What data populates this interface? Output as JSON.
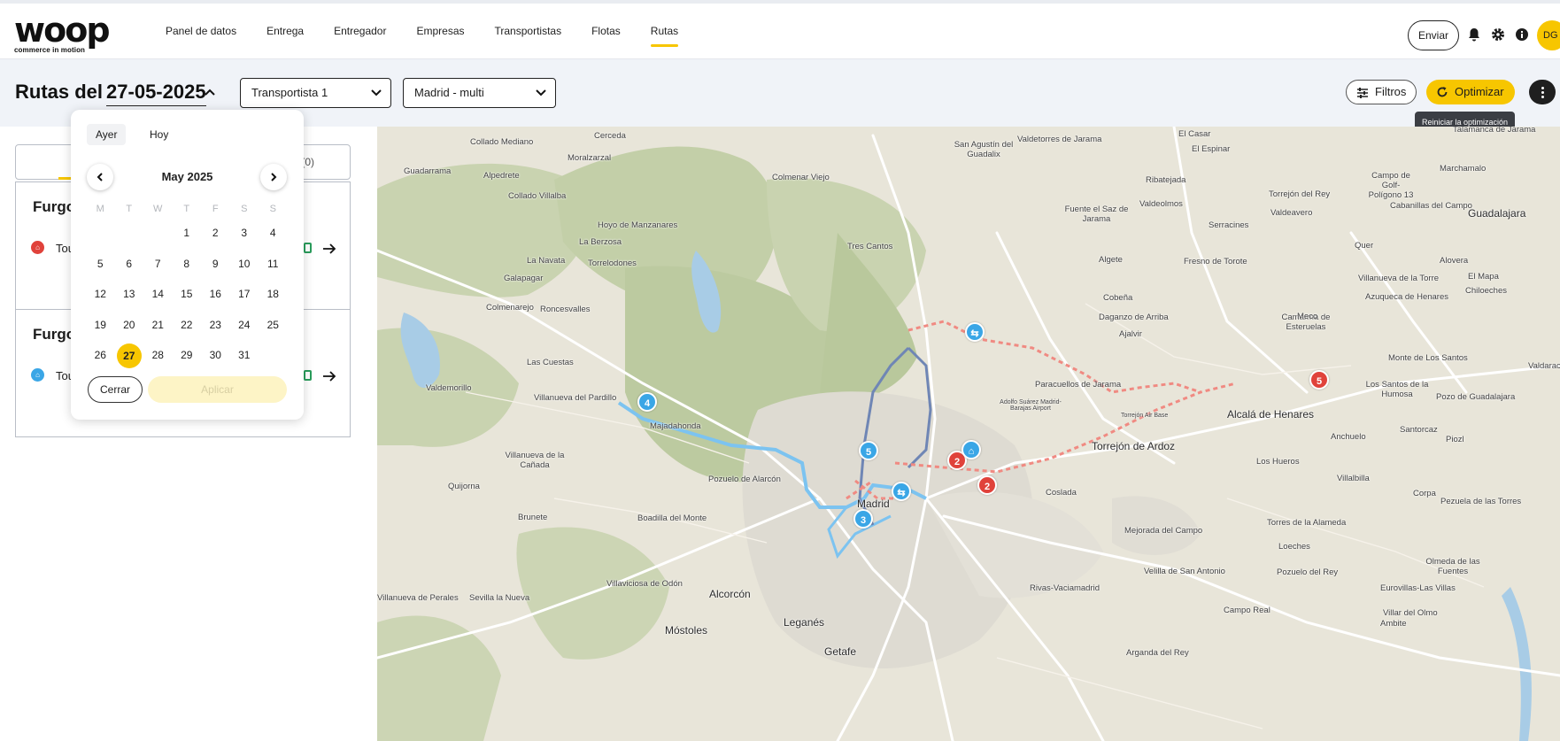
{
  "brand": {
    "logo_text": "woop",
    "tagline": "commerce in motion"
  },
  "nav": [
    {
      "label": "Panel de datos",
      "active": false
    },
    {
      "label": "Entrega",
      "active": false
    },
    {
      "label": "Entregador",
      "active": false
    },
    {
      "label": "Empresas",
      "active": false
    },
    {
      "label": "Transportistas",
      "active": false
    },
    {
      "label": "Flotas",
      "active": false
    },
    {
      "label": "Rutas",
      "active": true
    }
  ],
  "topbar": {
    "send_label": "Enviar",
    "avatar_initials": "DG",
    "icons": [
      "bell-icon",
      "gear-icon",
      "info-icon"
    ]
  },
  "header": {
    "title_prefix": "Rutas del",
    "date": "27-05-2025",
    "carrier_select": "Transportista 1",
    "zone_select": "Madrid - multi",
    "filters_label": "Filtros",
    "optimize_label": "Optimizar",
    "tooltip": "Reiniciar la optimización"
  },
  "colors": {
    "accent": "#f7c600",
    "route_blue": "#3aa6e6",
    "route_red": "#e0423b",
    "route_navy": "#6f86b5"
  },
  "left_panel": {
    "tab_count": "(0)",
    "cards": [
      {
        "title": "Furgo",
        "tour": "Tou",
        "dot_color": "#e0423b"
      },
      {
        "title": "Furgo",
        "tour": "Tou",
        "dot_color": "#3aa6e6"
      }
    ]
  },
  "calendar": {
    "quick": [
      "Ayer",
      "Hoy"
    ],
    "month_label": "May 2025",
    "weekdays": [
      "M",
      "T",
      "W",
      "T",
      "F",
      "S",
      "S"
    ],
    "weeks": [
      [
        "",
        "",
        "",
        "1",
        "2",
        "3",
        "4"
      ],
      [
        "5",
        "6",
        "7",
        "8",
        "9",
        "10",
        "11"
      ],
      [
        "12",
        "13",
        "14",
        "15",
        "16",
        "17",
        "18"
      ],
      [
        "19",
        "20",
        "21",
        "22",
        "23",
        "24",
        "25"
      ],
      [
        "26",
        "27",
        "28",
        "29",
        "30",
        "31",
        ""
      ]
    ],
    "selected_day": "27",
    "close_label": "Cerrar",
    "apply_label": "Aplicar"
  },
  "map": {
    "places": [
      "El Casar",
      "Talamanca de Jarama",
      "Cerceda",
      "Valdetorres de Jarama",
      "Collado Mediano",
      "San Agustín del Guadalix",
      "Moralzarzal",
      "El Espinar",
      "Guadarrama",
      "Colmenar Viejo",
      "Alpedrete",
      "Collado Villalba",
      "Ribatejada",
      "Campo de Golf- Polígono 13",
      "Marchamalo",
      "Torrejón del Rey",
      "Cabanillas del Campo",
      "Guadalajara",
      "Hoyo de Manzanares",
      "Fuente el Saz de Jarama",
      "Valdeolmos",
      "Valdeavero",
      "La Berzosa",
      "Serracines",
      "Tres Cantos",
      "Quer",
      "Alovera",
      "Fresno de Torote",
      "Algete",
      "La Navata",
      "Galapagar",
      "Torrelodones",
      "Villanueva de la Torre",
      "El Mapa",
      "Chiloeches",
      "Colmenarejo",
      "Roncesvalles",
      "Cobeña",
      "Azuqueca de Henares",
      "Daganzo de Arriba",
      "Camarma de Esteruelas",
      "Meco",
      "Ajalvir",
      "Las Cuestas",
      "Monte de Los Santos",
      "Paracuellos de Jarama",
      "Valdemorillo",
      "Villanueva del Pardillo",
      "Los Santos de la Humosa",
      "Adolfo Suárez Madrid-Barajas Airport",
      "Torrejón Air Base",
      "Alcalá de Henares",
      "Pozo de Guadalajara",
      "Majadahonda",
      "Valdarachas",
      "Santorcaz",
      "Anchuelo",
      "Torrejón de Ardoz",
      "Piozl",
      "Villanueva de la Cañada",
      "Los Hueros",
      "Pozuelo de Alarcón",
      "Quijorna",
      "Villalbilla",
      "Coslada",
      "Madrid",
      "Corpa",
      "Brunete",
      "Boadilla del Monte",
      "Pezuela de las Torres",
      "Torres de la Alameda",
      "Mejorada del Campo",
      "Loeches",
      "Olmeda de las Fuentes",
      "Velilla de San Antonio",
      "Pozuelo del Rey",
      "Villaviciosa de Odón",
      "Eurovillas-Las Villas",
      "Rivas-Vaciamadrid",
      "Alcorcón",
      "Villanueva de Perales",
      "Sevilla la Nueva",
      "Campo Real",
      "Villar del Olmo",
      "Leganés",
      "Móstoles",
      "Ambite",
      "Getafe",
      "Arganda del Rey"
    ],
    "markers": [
      {
        "label": "4",
        "color": "blue"
      },
      {
        "label": "5",
        "color": "blue"
      },
      {
        "label": "3",
        "color": "blue"
      },
      {
        "label": "2",
        "color": "red"
      },
      {
        "label": "2",
        "color": "red"
      },
      {
        "label": "5",
        "color": "red"
      }
    ]
  }
}
